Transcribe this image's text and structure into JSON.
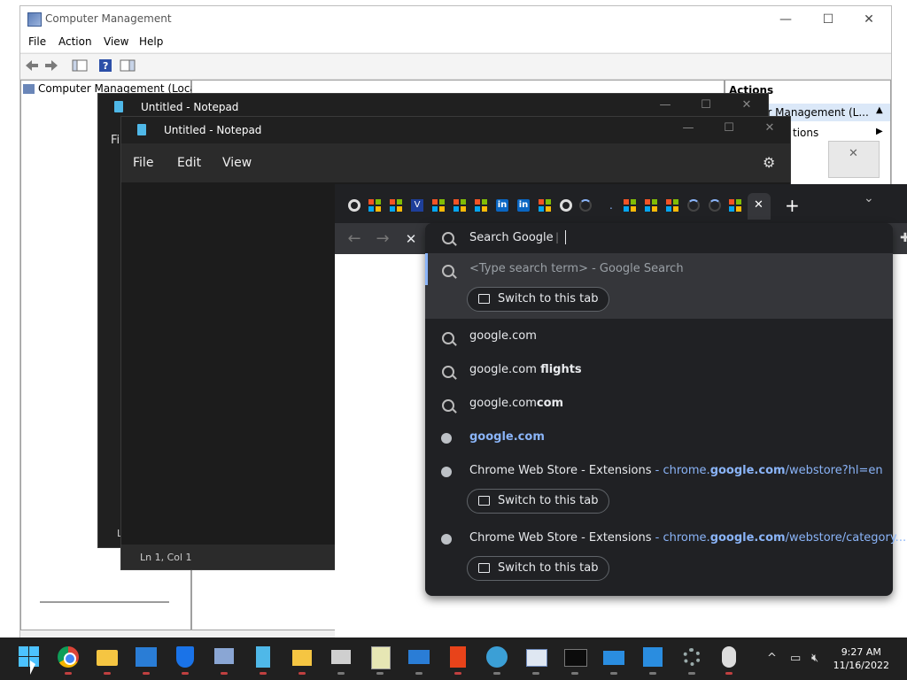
{
  "computer_management": {
    "title": "Computer Management",
    "menu": [
      "File",
      "Action",
      "View",
      "Help"
    ],
    "tree_root": "Computer Management (Local)",
    "actions_header": "Actions",
    "actions_item": "er Management (L...",
    "actions_sub": "tions",
    "window_buttons": {
      "minimize": "—",
      "maximize": "☐",
      "close": "✕"
    }
  },
  "notepad_back": {
    "title": "Untitled - Notepad",
    "menu_partial": "Fil",
    "status_partial": "L"
  },
  "notepad_front": {
    "title": "Untitled - Notepad",
    "menu": [
      "File",
      "Edit",
      "View"
    ],
    "status": "Ln 1, Col 1",
    "window_buttons": {
      "minimize": "—",
      "maximize": "☐",
      "close": "✕"
    }
  },
  "chrome": {
    "new_tab": "+",
    "tab_close": "✕",
    "tab_menu": "⌄",
    "nav": {
      "back": "←",
      "forward": "→",
      "stop": "✕"
    },
    "omnibox": {
      "value": "Search Google",
      "suggestions": [
        {
          "text": "<Type search term> - Google Search",
          "type": "search",
          "selected": true,
          "switch": "Switch to this tab"
        },
        {
          "text": "google.com",
          "bold": "",
          "type": "search"
        },
        {
          "text": "google.com ",
          "bold": "flights",
          "type": "search"
        },
        {
          "text": "google.com",
          "bold": "com",
          "type": "search"
        },
        {
          "text": "google.com",
          "type": "url"
        },
        {
          "title": "Chrome Web Store - Extensions",
          "sep": " - ",
          "url_pre": "chrome.",
          "url_bold": "google.com",
          "url_post": "/webstore?hl=en",
          "type": "history",
          "switch": "Switch to this tab"
        },
        {
          "title": "Chrome Web Store - Extensions",
          "sep": " - ",
          "url_pre": "chrome.",
          "url_bold": "google.com",
          "url_post": "/webstore/category...",
          "type": "history",
          "switch": "Switch to this tab"
        }
      ]
    }
  },
  "taskbar": {
    "time": "9:27 AM",
    "date": "11/16/2022",
    "tray_chevron": "^"
  },
  "colors": {
    "chrome_dark": "#202124",
    "link_blue": "#8ab4f8",
    "taskbar": "#202020"
  }
}
